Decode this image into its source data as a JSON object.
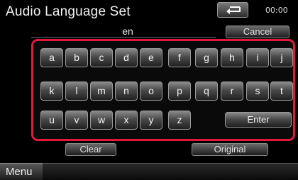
{
  "header": {
    "title": "Audio Language Set",
    "back_icon": "return-arrow-icon",
    "clock": "00:00"
  },
  "input": {
    "value": "en"
  },
  "buttons": {
    "cancel": "Cancel",
    "clear": "Clear",
    "original": "Original",
    "enter": "Enter"
  },
  "keyboard": {
    "rows": [
      [
        "a",
        "b",
        "c",
        "d",
        "e",
        "f",
        "g",
        "h",
        "i",
        "j"
      ],
      [
        "k",
        "l",
        "m",
        "n",
        "o",
        "p",
        "q",
        "r",
        "s",
        "t"
      ],
      [
        "u",
        "v",
        "w",
        "x",
        "y",
        "z"
      ]
    ],
    "frame_color": "#e2183c"
  },
  "footer": {
    "menu": "Menu"
  }
}
